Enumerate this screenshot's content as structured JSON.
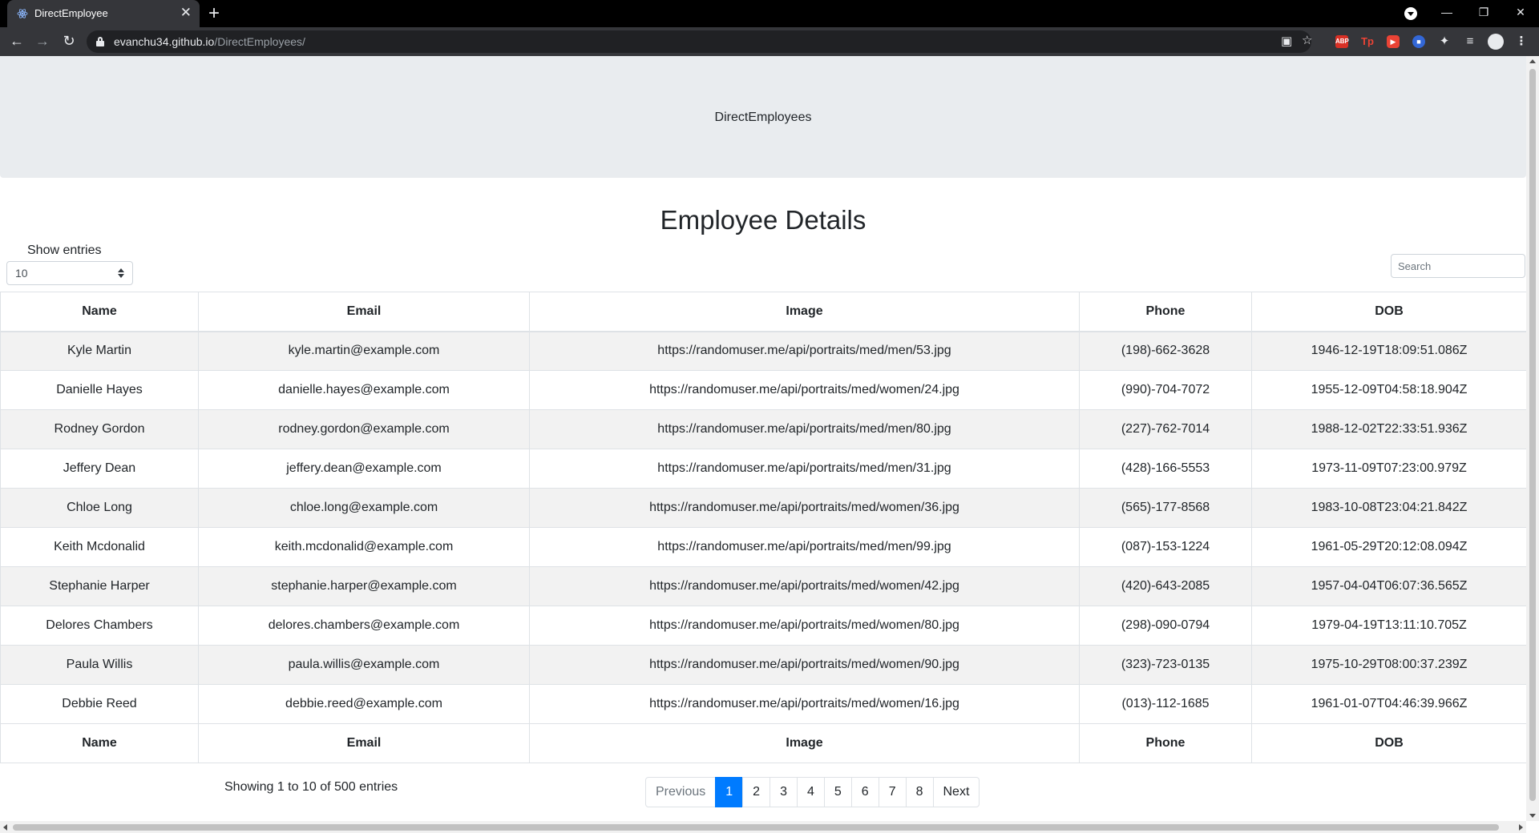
{
  "browser": {
    "tab_title": "DirectEmployee",
    "tab_close": "✕",
    "new_tab": "+",
    "url_host": "evanchu34.github.io",
    "url_path": "/DirectEmployees/",
    "icons": [
      "back-icon",
      "forward-icon",
      "reload-icon",
      "lock-icon",
      "qr-code-icon",
      "star-icon",
      "adblock-icon",
      "tp-icon",
      "video-icon",
      "extension-icon",
      "puzzle-icon",
      "media-control-icon",
      "profile-icon",
      "menu-icon"
    ],
    "extensions": {
      "adblock": "ABP",
      "tp": "Tp"
    }
  },
  "header": {
    "title": "DirectEmployees"
  },
  "main": {
    "heading": "Employee Details",
    "length_label": "Show entries",
    "length_value": "10",
    "search_placeholder": "Search"
  },
  "table": {
    "columns": [
      "Name",
      "Email",
      "Image",
      "Phone",
      "DOB"
    ],
    "rows": [
      [
        "Kyle Martin",
        "kyle.martin@example.com",
        "https://randomuser.me/api/portraits/med/men/53.jpg",
        "(198)-662-3628",
        "1946-12-19T18:09:51.086Z"
      ],
      [
        "Danielle Hayes",
        "danielle.hayes@example.com",
        "https://randomuser.me/api/portraits/med/women/24.jpg",
        "(990)-704-7072",
        "1955-12-09T04:58:18.904Z"
      ],
      [
        "Rodney Gordon",
        "rodney.gordon@example.com",
        "https://randomuser.me/api/portraits/med/men/80.jpg",
        "(227)-762-7014",
        "1988-12-02T22:33:51.936Z"
      ],
      [
        "Jeffery Dean",
        "jeffery.dean@example.com",
        "https://randomuser.me/api/portraits/med/men/31.jpg",
        "(428)-166-5553",
        "1973-11-09T07:23:00.979Z"
      ],
      [
        "Chloe Long",
        "chloe.long@example.com",
        "https://randomuser.me/api/portraits/med/women/36.jpg",
        "(565)-177-8568",
        "1983-10-08T23:04:21.842Z"
      ],
      [
        "Keith Mcdonalid",
        "keith.mcdonalid@example.com",
        "https://randomuser.me/api/portraits/med/men/99.jpg",
        "(087)-153-1224",
        "1961-05-29T20:12:08.094Z"
      ],
      [
        "Stephanie Harper",
        "stephanie.harper@example.com",
        "https://randomuser.me/api/portraits/med/women/42.jpg",
        "(420)-643-2085",
        "1957-04-04T06:07:36.565Z"
      ],
      [
        "Delores Chambers",
        "delores.chambers@example.com",
        "https://randomuser.me/api/portraits/med/women/80.jpg",
        "(298)-090-0794",
        "1979-04-19T13:11:10.705Z"
      ],
      [
        "Paula Willis",
        "paula.willis@example.com",
        "https://randomuser.me/api/portraits/med/women/90.jpg",
        "(323)-723-0135",
        "1975-10-29T08:00:37.239Z"
      ],
      [
        "Debbie Reed",
        "debbie.reed@example.com",
        "https://randomuser.me/api/portraits/med/women/16.jpg",
        "(013)-112-1685",
        "1961-01-07T04:46:39.966Z"
      ]
    ]
  },
  "footer": {
    "info": "Showing 1 to 10 of 500 entries",
    "previous": "Previous",
    "pages": [
      "1",
      "2",
      "3",
      "4",
      "5",
      "6",
      "7",
      "8"
    ],
    "active_page": "1",
    "next": "Next"
  },
  "colors": {
    "accent": "#007bff",
    "jumbotron": "#e9ecef",
    "stripe": "#f2f2f2"
  }
}
